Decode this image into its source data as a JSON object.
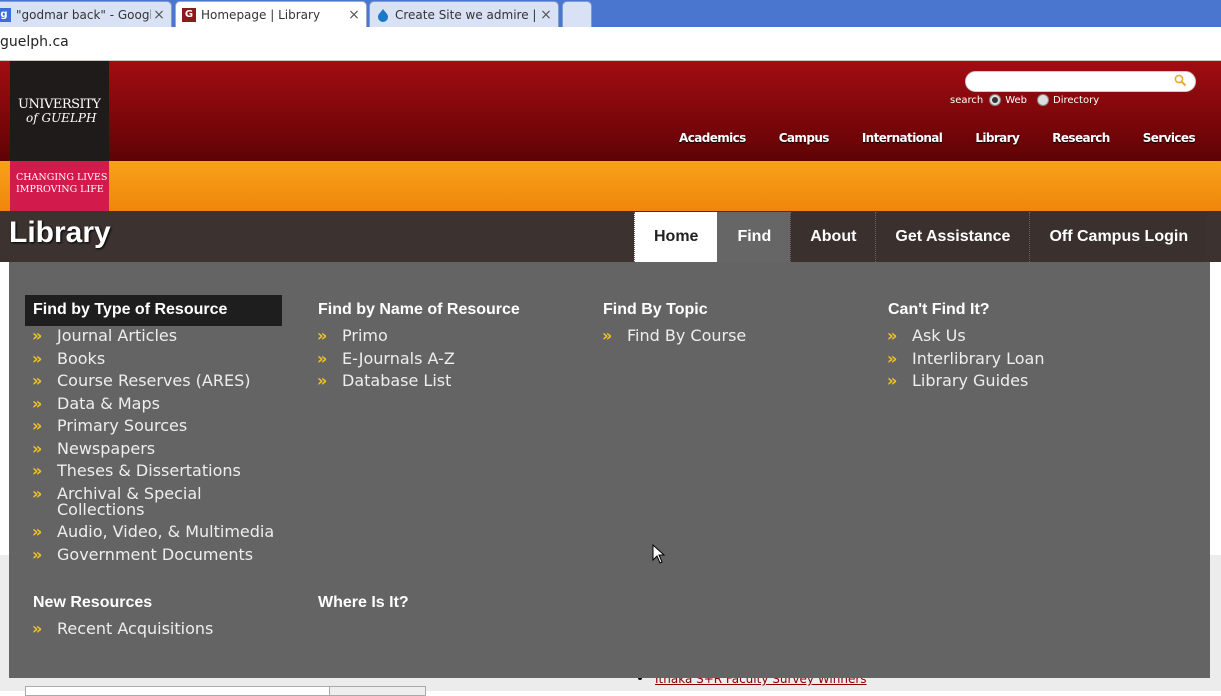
{
  "browser": {
    "tabs": [
      {
        "title": "\"godmar back\" - Google S",
        "favicon": "google-icon",
        "active": false
      },
      {
        "title": "Homepage | Library",
        "favicon": "guelph-g-icon",
        "active": true
      },
      {
        "title": "Create Site we admire | co",
        "favicon": "drupal-icon",
        "active": false
      }
    ],
    "url": "guelph.ca"
  },
  "header": {
    "logo_line1": "UNIVERSITY",
    "logo_line2": "of GUELPH",
    "slogan_line1": "CHANGING LIVES",
    "slogan_line2": "IMPROVING LIFE",
    "search_label": "search",
    "search_placeholder": "",
    "radio_web": "Web",
    "radio_directory": "Directory",
    "nav": [
      "Academics",
      "Campus",
      "International",
      "Library",
      "Research",
      "Services"
    ]
  },
  "library": {
    "title": "Library",
    "tabs": [
      "Home",
      "Find",
      "About",
      "Get Assistance",
      "Off Campus Login"
    ],
    "active_tab": "Find"
  },
  "menu": {
    "col1": {
      "heading": "Find by Type of Resource",
      "items": [
        "Journal Articles",
        "Books",
        "Course Reserves (ARES)",
        "Data & Maps",
        "Primary Sources",
        "Newspapers",
        "Theses & Dissertations",
        "Archival & Special Collections",
        "Audio, Video, & Multimedia",
        "Government Documents"
      ]
    },
    "col2": {
      "heading": "Find by Name of Resource",
      "items": [
        "Primo",
        "E-Journals A-Z",
        "Database List"
      ]
    },
    "col3": {
      "heading": "Find By Topic",
      "items": [
        "Find By Course"
      ]
    },
    "col4": {
      "heading": "Can't Find It?",
      "items": [
        "Ask Us",
        "Interlibrary Loan",
        "Library Guides"
      ]
    },
    "new_resources": {
      "heading": "New Resources",
      "items": [
        "Recent Acquisitions"
      ]
    },
    "where_is_it": {
      "heading": "Where Is It?"
    }
  },
  "page": {
    "news_item": "Ithaka S+R Faculty Survey Winners"
  },
  "colors": {
    "header_red": "#8b0a0e",
    "orange_band": "#f39214",
    "slogan_pink": "#d21a4c",
    "menu_gray": "#646464",
    "chevron_gold": "#f2c224"
  }
}
